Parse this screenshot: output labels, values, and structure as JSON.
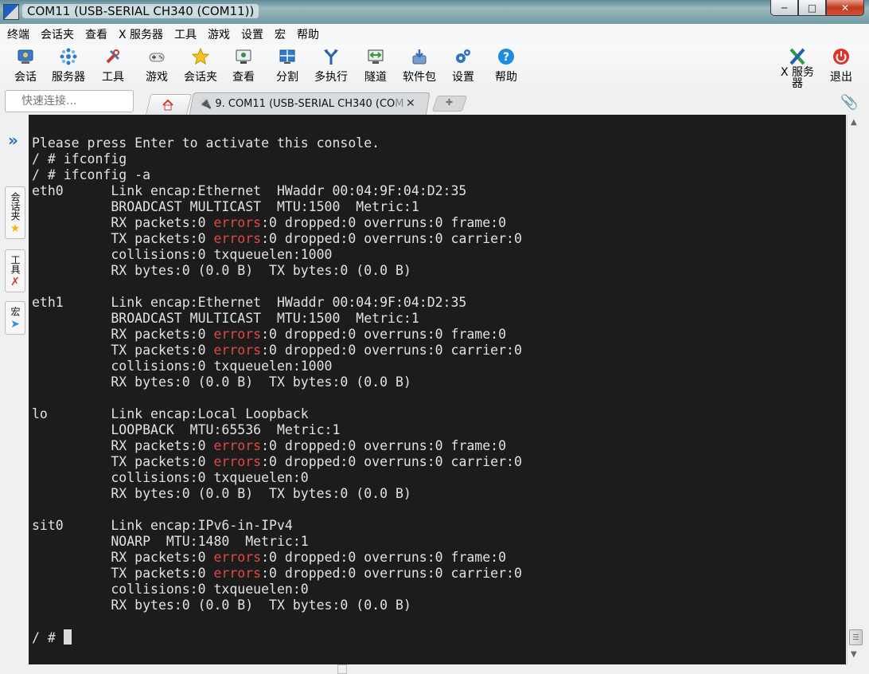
{
  "window": {
    "title": "COM11  (USB-SERIAL CH340 (COM11))"
  },
  "menu": [
    "终端",
    "会话夹",
    "查看",
    "X 服务器",
    "工具",
    "游戏",
    "设置",
    "宏",
    "帮助"
  ],
  "toolbar": {
    "items": [
      "会话",
      "服务器",
      "工具",
      "游戏",
      "会话夹",
      "查看",
      "分割",
      "多执行",
      "隧道",
      "软件包",
      "设置",
      "帮助"
    ],
    "xserver_label": "X 服务器",
    "exit_label": "退出"
  },
  "quick_connect": {
    "placeholder": "快速连接..."
  },
  "tab": {
    "title_main": "9. COM11  (USB-SERIAL CH340 (CO",
    "title_fade": "M",
    "close": "✕"
  },
  "side_tabs": {
    "sessions": "会话夹",
    "tools": "工具",
    "macros": "宏"
  },
  "terminal": {
    "prompt_final": "/ # ",
    "lines": [
      "Please press Enter to activate this console.",
      "/ # ifconfig",
      "/ # ifconfig -a",
      "eth0      Link encap:Ethernet  HWaddr 00:04:9F:04:D2:35",
      "          BROADCAST MULTICAST  MTU:1500  Metric:1",
      "          RX packets:0 errors:0 dropped:0 overruns:0 frame:0",
      "          TX packets:0 errors:0 dropped:0 overruns:0 carrier:0",
      "          collisions:0 txqueuelen:1000",
      "          RX bytes:0 (0.0 B)  TX bytes:0 (0.0 B)",
      "",
      "eth1      Link encap:Ethernet  HWaddr 00:04:9F:04:D2:35",
      "          BROADCAST MULTICAST  MTU:1500  Metric:1",
      "          RX packets:0 errors:0 dropped:0 overruns:0 frame:0",
      "          TX packets:0 errors:0 dropped:0 overruns:0 carrier:0",
      "          collisions:0 txqueuelen:1000",
      "          RX bytes:0 (0.0 B)  TX bytes:0 (0.0 B)",
      "",
      "lo        Link encap:Local Loopback",
      "          LOOPBACK  MTU:65536  Metric:1",
      "          RX packets:0 errors:0 dropped:0 overruns:0 frame:0",
      "          TX packets:0 errors:0 dropped:0 overruns:0 carrier:0",
      "          collisions:0 txqueuelen:0",
      "          RX bytes:0 (0.0 B)  TX bytes:0 (0.0 B)",
      "",
      "sit0      Link encap:IPv6-in-IPv4",
      "          NOARP  MTU:1480  Metric:1",
      "          RX packets:0 errors:0 dropped:0 overruns:0 frame:0",
      "          TX packets:0 errors:0 dropped:0 overruns:0 carrier:0",
      "          collisions:0 txqueuelen:0",
      "          RX bytes:0 (0.0 B)  TX bytes:0 (0.0 B)",
      ""
    ]
  },
  "colors": {
    "terminal_bg": "#1c1c1c",
    "terminal_fg": "#e2e2e2",
    "error_word": "#e04848"
  }
}
